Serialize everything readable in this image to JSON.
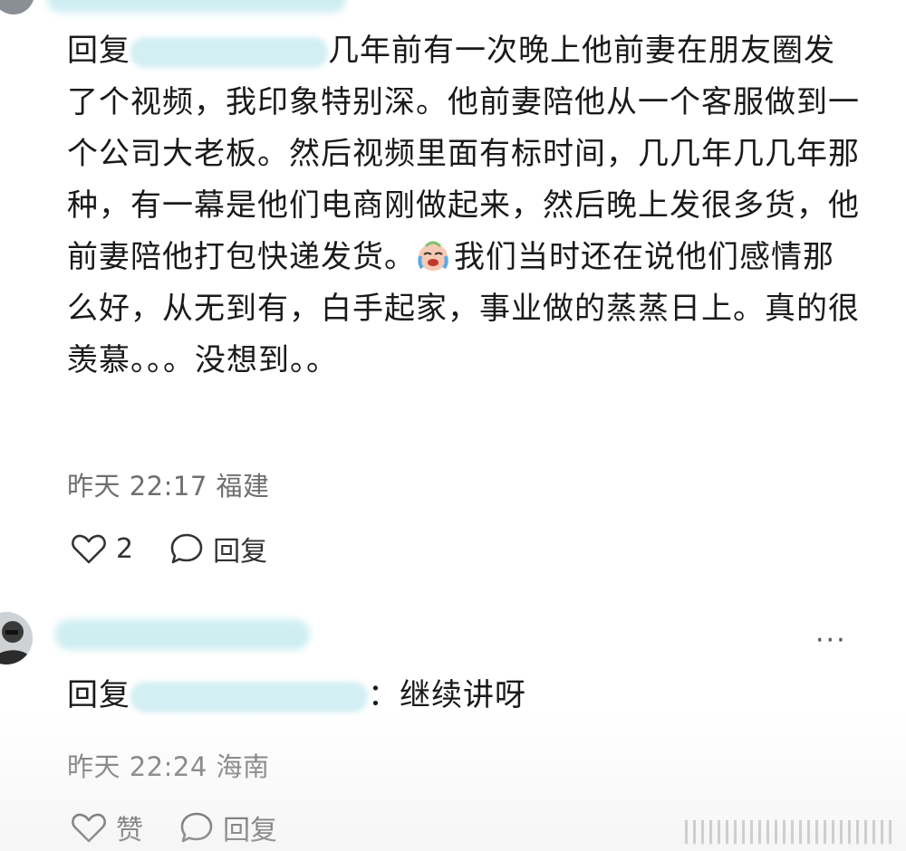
{
  "comment1": {
    "reply_prefix": "回复",
    "text_first": "几年前有一次晚上他前妻在朋友圈发了个视频，我印象特别深。他前妻陪他从一个客服做到一个公司大老板。然后视频里面有标时间，几几年几几年那种，有一幕是他们电商刚做起来，然后晚上发很多货，他前妻陪他打包快递发货。",
    "emoji_icon": "crying-laughing-emoji-icon",
    "text_second": "我们当时还在说他们感情那么好，从无到有，白手起家，事业做的蒸蒸日上。真的很羡慕。。。没想到。。",
    "time": "昨天 22:17",
    "location": "福建",
    "like_count": "2",
    "reply_label": "回复"
  },
  "comment2": {
    "more_icon": "ellipsis-icon",
    "reply_prefix": "回复",
    "text": "：继续讲呀",
    "time": "昨天 22:24",
    "location": "海南",
    "like_label": "赞",
    "reply_label": "回复"
  },
  "colors": {
    "text": "#1a1a1a",
    "meta": "#6f6f6f",
    "blur": "#cfeef2"
  }
}
